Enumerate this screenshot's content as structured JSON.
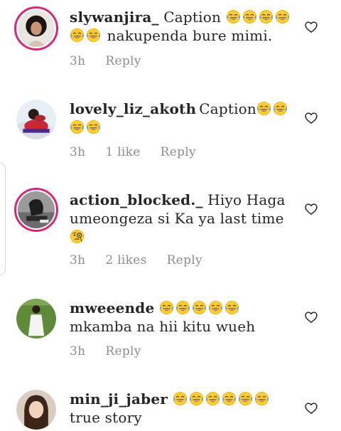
{
  "colors": {
    "text": "#262626",
    "meta": "#8e8e8e",
    "story_ring": "#d62976"
  },
  "comments": [
    {
      "username": "slywanjira_",
      "text_before": "Caption",
      "emoji_line1": [
        "face-with-tears-of-joy",
        "face-with-tears-of-joy",
        "face-with-tears-of-joy",
        "face-with-tears-of-joy"
      ],
      "emoji_line2": [
        "face-with-tears-of-joy",
        "face-with-tears-of-joy"
      ],
      "text_after": "nakupenda bure mimi.",
      "time": "3h",
      "likes": "",
      "reply": "Reply"
    },
    {
      "username": "lovely_liz_akoth",
      "text_before": "Caption",
      "emoji_line1": [
        "face-with-tears-of-joy",
        "face-with-tears-of-joy"
      ],
      "emoji_line2": [
        "face-with-tears-of-joy",
        "face-with-tears-of-joy"
      ],
      "text_after": "",
      "time": "3h",
      "likes": "1 like",
      "reply": "Reply"
    },
    {
      "username": "action_blocked._",
      "text_line1": "Hiyo Haga",
      "text_line2": "umeongeza si Ka ya last time",
      "emoji_line3": [
        "face-with-monocle"
      ],
      "time": "3h",
      "likes": "2 likes",
      "reply": "Reply"
    },
    {
      "username": "mweeende",
      "emoji_line1": [
        "face-with-tears-of-joy",
        "face-with-tears-of-joy",
        "face-with-tears-of-joy",
        "face-with-tears-of-joy",
        "face-with-tears-of-joy"
      ],
      "text_line2": "mkamba na hii kitu wueh",
      "time": "3h",
      "likes": "",
      "reply": "Reply"
    },
    {
      "username": "min_ji_jaber",
      "emoji_line1": [
        "face-with-tears-of-joy",
        "face-with-tears-of-joy",
        "face-with-tears-of-joy",
        "face-with-tears-of-joy",
        "face-with-tears-of-joy",
        "face-with-tears-of-joy"
      ],
      "text_line2": "true story"
    }
  ],
  "icons": {
    "like": "heart-outline-icon",
    "laugh": "face-with-tears-of-joy",
    "monocle": "face-with-monocle"
  }
}
